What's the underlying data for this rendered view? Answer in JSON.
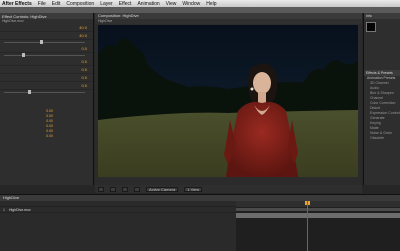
{
  "menubar": {
    "app": "After Effects",
    "items": [
      "File",
      "Edit",
      "Composition",
      "Layer",
      "Effect",
      "Animation",
      "View",
      "Window",
      "Help"
    ]
  },
  "window_title": "",
  "left_panel": {
    "tab": "Effect Controls: HighDive",
    "sub": "HighDive.mov",
    "rows": [
      {
        "label": "",
        "value": "40.0"
      },
      {
        "label": "",
        "value": "40.0"
      },
      {
        "label": "",
        "value": ""
      },
      {
        "label": "",
        "value": "0.0"
      },
      {
        "label": "",
        "value": "0.0"
      },
      {
        "label": "",
        "value": "0.0"
      },
      {
        "label": "",
        "value": "0.0"
      },
      {
        "label": "",
        "value": "0.0"
      }
    ],
    "lower_rows": [
      {
        "label": "",
        "value": "0.00"
      },
      {
        "label": "",
        "value": "0.00"
      },
      {
        "label": "",
        "value": "0.00"
      },
      {
        "label": "",
        "value": "0.00"
      },
      {
        "label": "",
        "value": "0.00"
      },
      {
        "label": "",
        "value": "0.00"
      }
    ]
  },
  "comp_panel": {
    "tab": "Composition: HighDive",
    "sub": "HighDive",
    "footer": {
      "zoom": "",
      "time": "",
      "quality": "",
      "view": "",
      "camera": "Active Camera",
      "views": "1 View"
    }
  },
  "right_panel": {
    "tab": "Info",
    "swatch_label": "",
    "section": "Effects & Presets",
    "items": [
      "Animation Presets",
      "3D Channel",
      "Audio",
      "Blur & Sharpen",
      "Channel",
      "Color Correction",
      "Distort",
      "Expression Controls",
      "Generate",
      "Keying",
      "Matte",
      "Noise & Grain",
      "Obsolete"
    ]
  },
  "timeline": {
    "tab": "HighDive",
    "time": "",
    "layer_name": "HighDive.mov",
    "playhead_percent": 43
  },
  "colors": {
    "accent": "#e8a63a",
    "playhead": "#dd3333",
    "panel": "#2e2e2e"
  }
}
